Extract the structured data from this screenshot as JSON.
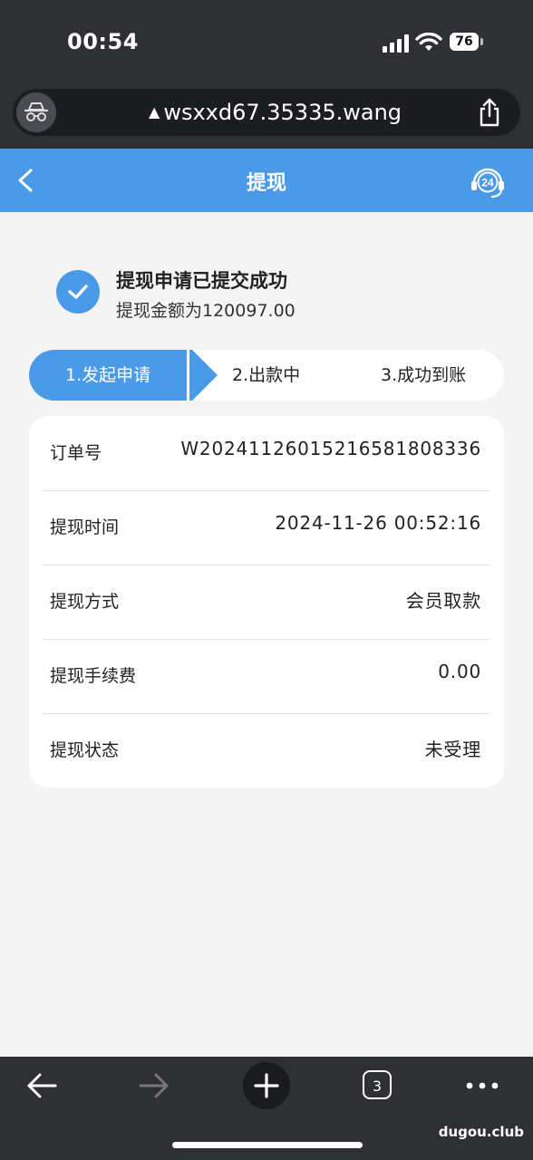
{
  "status_bar": {
    "time": "00:54",
    "battery_level": "76"
  },
  "browser": {
    "url": "wsxxd67.35335.wang",
    "url_warning_icon": "warning-icon",
    "open_tabs": "3"
  },
  "header": {
    "title": "提现",
    "support_badge": "24"
  },
  "success": {
    "title": "提现申请已提交成功",
    "amount_text": "提现金额为120097.00"
  },
  "steps": [
    {
      "label": "1.发起申请",
      "active": true
    },
    {
      "label": "2.出款中",
      "active": false
    },
    {
      "label": "3.成功到账",
      "active": false
    }
  ],
  "details": [
    {
      "label": "订单号",
      "value": "W2024112601521658180833​6"
    },
    {
      "label": "提现时间",
      "value": "2024-11-26 00:52:16"
    },
    {
      "label": "提现方式",
      "value": "会员取款"
    },
    {
      "label": "提现手续费",
      "value": "0.00"
    },
    {
      "label": "提现状态",
      "value": "未受理"
    }
  ],
  "watermark": "dugou.club",
  "colors": {
    "accent": "#4b9ae8",
    "chrome": "#2e3034",
    "page_bg": "#f4f4f4"
  }
}
